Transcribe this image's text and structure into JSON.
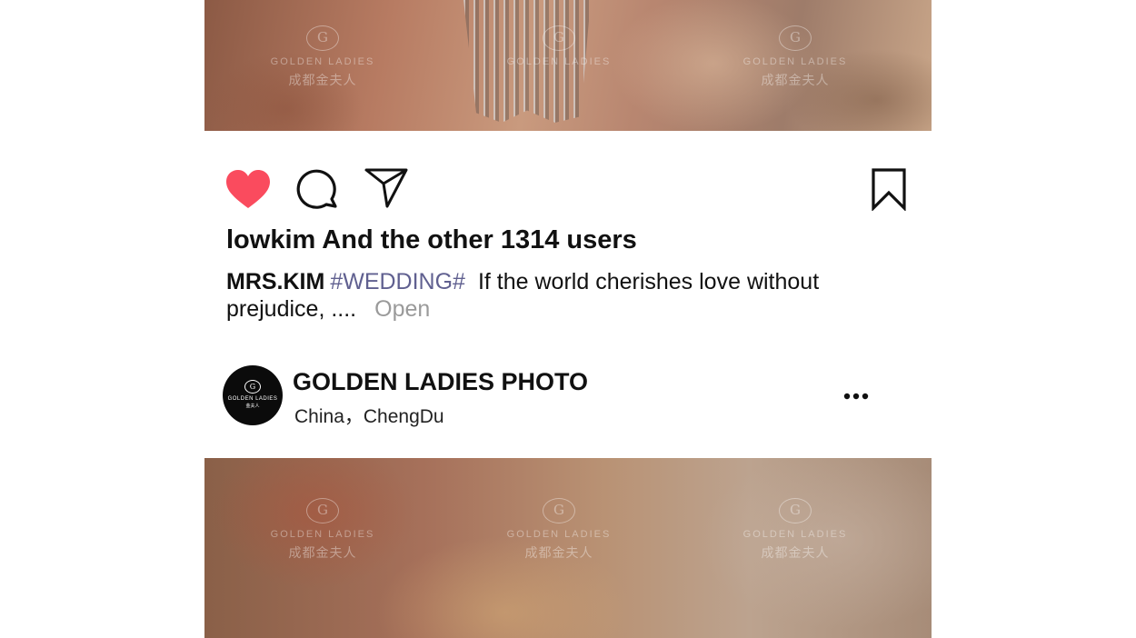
{
  "photos": {
    "top": {
      "watermarks": [
        {
          "mark": "G",
          "brand": "GOLDEN LADIES",
          "cn": "成都金夫人"
        },
        {
          "mark": "G",
          "brand": "GOLDEN LADIES",
          "cn": ""
        },
        {
          "mark": "G",
          "brand": "GOLDEN LADIES",
          "cn": "成都金夫人"
        }
      ]
    },
    "bottom": {
      "watermarks": [
        {
          "mark": "G",
          "brand": "GOLDEN LADIES",
          "cn": "成都金夫人"
        },
        {
          "mark": "G",
          "brand": "GOLDEN LADIES",
          "cn": "成都金夫人"
        },
        {
          "mark": "G",
          "brand": "GOLDEN LADIES",
          "cn": "成都金夫人"
        }
      ]
    }
  },
  "actions": {
    "icons": [
      "heart-icon",
      "comment-icon",
      "share-icon",
      "bookmark-icon"
    ],
    "like_color": "#fa4b5e",
    "liked": true
  },
  "post": {
    "likes_text": "lowkim And the other 1314 users",
    "caption_user": "MRS.KIM",
    "caption_tag": "#WEDDING#",
    "caption_text": "If the world cherishes love without prejudice, ....",
    "more_label": "Open"
  },
  "account": {
    "avatar_mark": "G",
    "avatar_line1": "GOLDEN LADIES",
    "avatar_line2": "金夫人",
    "name": "GOLDEN LADIES PHOTO",
    "location": "China，ChengDu",
    "menu_icon": "more-dots-icon"
  },
  "colors": {
    "hashtag": "#606090",
    "muted": "#9a9a9a"
  }
}
